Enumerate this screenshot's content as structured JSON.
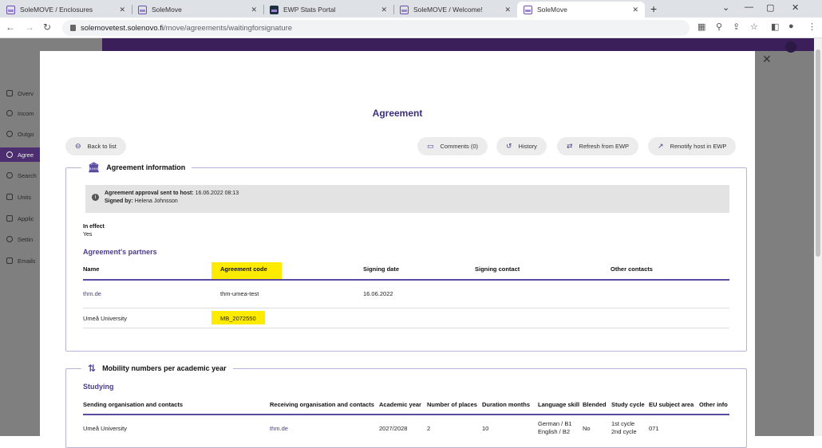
{
  "browser": {
    "tabs": [
      {
        "title": "SoleMOVE / Enclosures",
        "active": false,
        "icon": "solemove-icon"
      },
      {
        "title": "SoleMove",
        "active": false,
        "icon": "solemove-icon"
      },
      {
        "title": "EWP Stats Portal",
        "active": false,
        "icon": "ewp-icon"
      },
      {
        "title": "SoleMOVE / Welcome!",
        "active": false,
        "icon": "solemove-icon"
      },
      {
        "title": "SoleMove",
        "active": true,
        "icon": "solemove-icon"
      }
    ],
    "url_host": "solemovetest.solenovo.fi",
    "url_path": "/move/agreements/waitingforsignature"
  },
  "sidebar": {
    "items": [
      {
        "label": "Overv",
        "icon": "overview-icon"
      },
      {
        "label": "Incom",
        "icon": "incoming-icon"
      },
      {
        "label": "Outgo",
        "icon": "outgoing-icon"
      },
      {
        "label": "Agree",
        "icon": "agreement-icon",
        "active": true
      },
      {
        "label": "Search",
        "icon": "search-icon"
      },
      {
        "label": "Units",
        "icon": "units-icon"
      },
      {
        "label": "Applic",
        "icon": "application-icon"
      },
      {
        "label": "Settin",
        "icon": "settings-icon"
      },
      {
        "label": "Emails",
        "icon": "email-icon"
      }
    ]
  },
  "modal": {
    "title": "Agreement",
    "buttons": {
      "back": "Back to list",
      "comments": "Comments (0)",
      "history": "History",
      "refresh": "Refresh from EWP",
      "renotify": "Renotify host in EWP"
    },
    "agreement_info": {
      "heading": "Agreement information",
      "notice_line1_bold": "Agreement approval sent to host:",
      "notice_line1_value": "16.06.2022 08:13",
      "notice_line2_bold": "Signed by:",
      "notice_line2_value": "Helena Johnsson",
      "in_effect_label": "In effect",
      "in_effect_value": "Yes",
      "partners_heading": "Agreement's partners",
      "partners_columns": [
        "Name",
        "Agreement code",
        "Signing date",
        "Signing contact",
        "Other contacts"
      ],
      "partners_rows": [
        {
          "name": "thm.de",
          "code": "thm-umea-test",
          "signing_date": "16.06.2022",
          "signing_contact": "",
          "other": ""
        },
        {
          "name": "Umeå University",
          "code": "MB_2072550",
          "signing_date": "",
          "signing_contact": "",
          "other": ""
        }
      ]
    },
    "mobility": {
      "heading": "Mobility numbers per academic year",
      "sub_heading": "Studying",
      "columns": [
        "Sending organisation and contacts",
        "Receiving organisation and contacts",
        "Academic year",
        "Number of places",
        "Duration months",
        "Language skill",
        "Blended",
        "Study cycle",
        "EU subject area",
        "Other info"
      ],
      "row": {
        "sending": "Umeå University",
        "receiving": "thm.de",
        "year": "2027/2028",
        "places": "2",
        "duration": "10",
        "language1": "German / B1",
        "language2": "English / B2",
        "blended": "No",
        "cycle1": "1st cycle",
        "cycle2": "2nd cycle",
        "eu_area": "071",
        "other": ""
      }
    }
  }
}
